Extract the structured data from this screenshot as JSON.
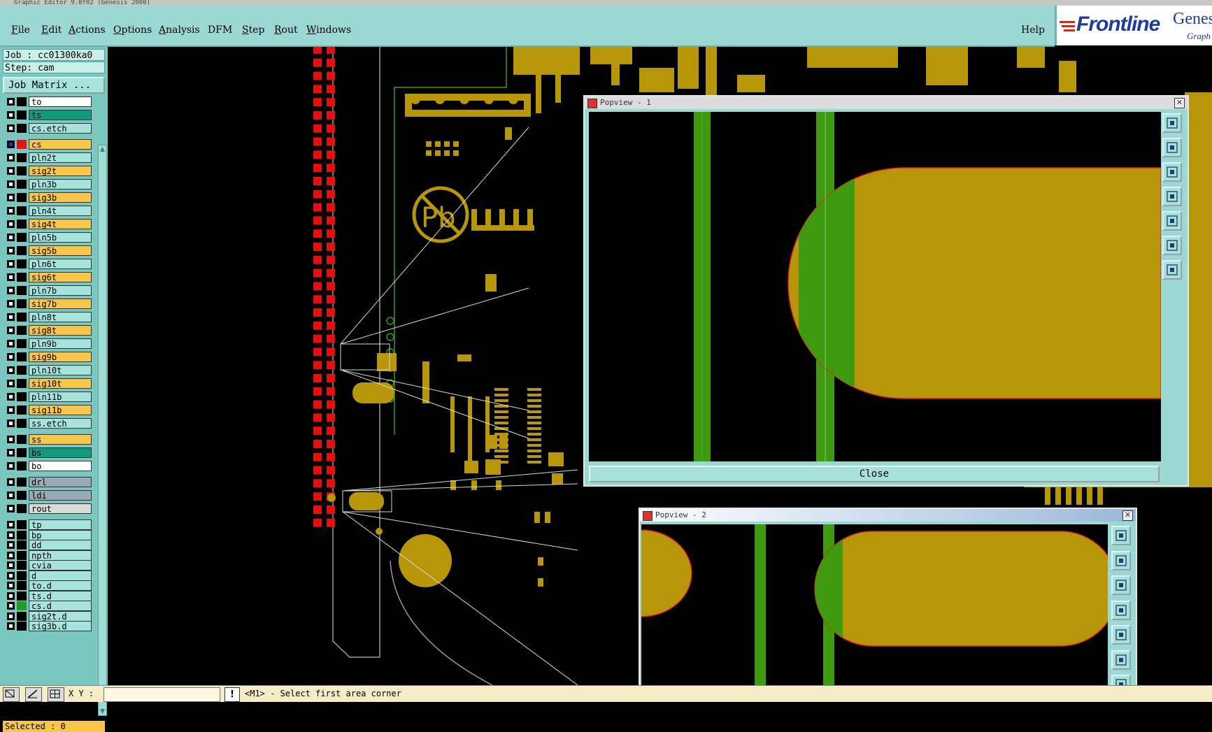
{
  "window_title": "Graphic Editor 9.0f02 (Genesis 2000)",
  "menubar": {
    "items": [
      {
        "label": "File",
        "key": "F",
        "rest": "ile"
      },
      {
        "label": "Edit",
        "key": "E",
        "rest": "dit"
      },
      {
        "label": "Actions",
        "key": "A",
        "rest": "ctions"
      },
      {
        "label": "Options",
        "key": "O",
        "rest": "ptions"
      },
      {
        "label": "Analysis",
        "key": "A",
        "rest": "nalysis"
      },
      {
        "label": "DFM",
        "key": "",
        "rest": "DFM"
      },
      {
        "label": "Step",
        "key": "S",
        "rest": "tep"
      },
      {
        "label": "Rout",
        "key": "R",
        "rest": "out"
      },
      {
        "label": "Windows",
        "key": "W",
        "rest": "indows"
      }
    ],
    "help_label": "Help"
  },
  "logo": {
    "brand": "Frontline",
    "product": "Genes",
    "sub": "Graph"
  },
  "left_panel": {
    "job": "Job : cc01300ka0",
    "step": "Step: cam",
    "job_matrix_button": "Job Matrix ...",
    "selected": "Selected : 0"
  },
  "layers": [
    {
      "name": "to",
      "color": "#ffffff",
      "swatch": "#000000"
    },
    {
      "name": "ts",
      "color": "#139a7e",
      "swatch": "#000000"
    },
    {
      "name": "cs.etch",
      "color": "#a8e2dc",
      "swatch": "#000000"
    },
    {
      "name": "cs",
      "color": "#f7c64b",
      "swatch": "#e01515",
      "checked_color": "#2233cc"
    },
    {
      "name": "pln2t",
      "color": "#a8e2dc",
      "swatch": "#000000"
    },
    {
      "name": "sig2t",
      "color": "#f7c64b",
      "swatch": "#000000"
    },
    {
      "name": "pln3b",
      "color": "#a8e2dc",
      "swatch": "#000000"
    },
    {
      "name": "sig3b",
      "color": "#f7c64b",
      "swatch": "#000000"
    },
    {
      "name": "pln4t",
      "color": "#a8e2dc",
      "swatch": "#000000"
    },
    {
      "name": "sig4t",
      "color": "#f7c64b",
      "swatch": "#000000"
    },
    {
      "name": "pln5b",
      "color": "#a8e2dc",
      "swatch": "#000000"
    },
    {
      "name": "sig5b",
      "color": "#f7c64b",
      "swatch": "#000000"
    },
    {
      "name": "pln6t",
      "color": "#a8e2dc",
      "swatch": "#000000"
    },
    {
      "name": "sig6t",
      "color": "#f7c64b",
      "swatch": "#000000"
    },
    {
      "name": "pln7b",
      "color": "#a8e2dc",
      "swatch": "#000000"
    },
    {
      "name": "sig7b",
      "color": "#f7c64b",
      "swatch": "#000000"
    },
    {
      "name": "pln8t",
      "color": "#a8e2dc",
      "swatch": "#000000"
    },
    {
      "name": "sig8t",
      "color": "#f7c64b",
      "swatch": "#000000"
    },
    {
      "name": "pln9b",
      "color": "#a8e2dc",
      "swatch": "#000000"
    },
    {
      "name": "sig9b",
      "color": "#f7c64b",
      "swatch": "#000000"
    },
    {
      "name": "pln10t",
      "color": "#a8e2dc",
      "swatch": "#000000"
    },
    {
      "name": "sig10t",
      "color": "#f7c64b",
      "swatch": "#000000"
    },
    {
      "name": "pln11b",
      "color": "#a8e2dc",
      "swatch": "#000000"
    },
    {
      "name": "sig11b",
      "color": "#f7c64b",
      "swatch": "#000000"
    },
    {
      "name": "ss.etch",
      "color": "#a8e2dc",
      "swatch": "#000000"
    },
    {
      "name": "ss",
      "color": "#f7c64b",
      "swatch": "#000000"
    },
    {
      "name": "bs",
      "color": "#139a7e",
      "swatch": "#000000"
    },
    {
      "name": "bo",
      "color": "#ffffff",
      "swatch": "#000000"
    },
    {
      "name": "drl",
      "color": "#9aa9b5",
      "swatch": "#000000"
    },
    {
      "name": "ldi",
      "color": "#9aa9b5",
      "swatch": "#000000"
    },
    {
      "name": "rout",
      "color": "#d9d9d9",
      "swatch": "#000000"
    },
    {
      "name": "tp",
      "color": "#a8e2dc",
      "swatch": "#000000"
    },
    {
      "name": "bp",
      "color": "#a8e2dc",
      "swatch": "#000000"
    },
    {
      "name": "dd",
      "color": "#a8e2dc",
      "swatch": "#000000"
    },
    {
      "name": "npth",
      "color": "#a8e2dc",
      "swatch": "#000000"
    },
    {
      "name": "cvia",
      "color": "#a8e2dc",
      "swatch": "#000000"
    },
    {
      "name": "d",
      "color": "#a8e2dc",
      "swatch": "#000000"
    },
    {
      "name": "to.d",
      "color": "#a8e2dc",
      "swatch": "#000000"
    },
    {
      "name": "ts.d",
      "color": "#a8e2dc",
      "swatch": "#000000"
    },
    {
      "name": "cs.d",
      "color": "#a8e2dc",
      "swatch": "#1f9d1f"
    },
    {
      "name": "sig2t.d",
      "color": "#a8e2dc",
      "swatch": "#000000"
    },
    {
      "name": "sig3b.d",
      "color": "#a8e2dc",
      "swatch": "#000000"
    }
  ],
  "popview1": {
    "title": "Popview - 1",
    "close_label": "Close"
  },
  "popview2": {
    "title": "Popview - 2"
  },
  "status": {
    "xy_label": "X Y :",
    "xy_value": "",
    "message": "<M1> - Select first area corner"
  },
  "colors": {
    "copper": "#b8960a",
    "green": "#3f9a10",
    "outline": "#e02020",
    "panel": "#9cd8d3"
  }
}
